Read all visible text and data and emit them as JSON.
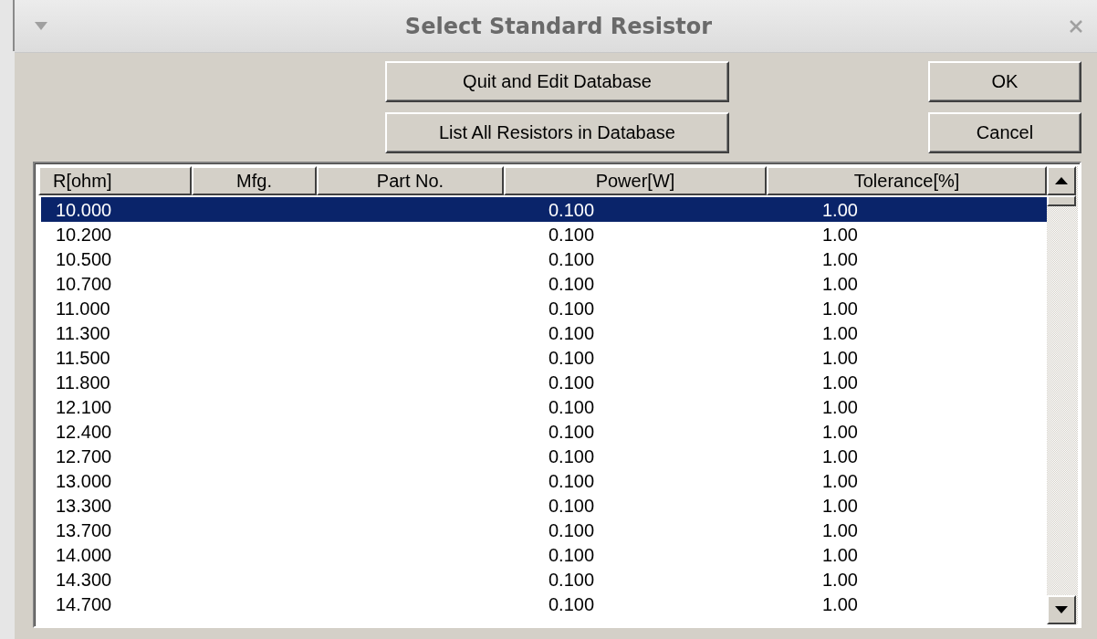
{
  "window": {
    "title": "Select Standard Resistor"
  },
  "buttons": [
    {
      "label": "Quit and Edit Database"
    },
    {
      "label": "OK"
    },
    {
      "label": "List All Resistors in Database"
    },
    {
      "label": "Cancel"
    }
  ],
  "table": {
    "columns": [
      "R[ohm]",
      "Mfg.",
      "Part No.",
      "Power[W]",
      "Tolerance[%]"
    ],
    "rows": [
      {
        "r": "10.000",
        "power": "0.100",
        "tolerance": "1.00",
        "selected": true
      },
      {
        "r": "10.200",
        "power": "0.100",
        "tolerance": "1.00",
        "selected": false
      },
      {
        "r": "10.500",
        "power": "0.100",
        "tolerance": "1.00",
        "selected": false
      },
      {
        "r": "10.700",
        "power": "0.100",
        "tolerance": "1.00",
        "selected": false
      },
      {
        "r": "11.000",
        "power": "0.100",
        "tolerance": "1.00",
        "selected": false
      },
      {
        "r": "11.300",
        "power": "0.100",
        "tolerance": "1.00",
        "selected": false
      },
      {
        "r": "11.500",
        "power": "0.100",
        "tolerance": "1.00",
        "selected": false
      },
      {
        "r": "11.800",
        "power": "0.100",
        "tolerance": "1.00",
        "selected": false
      },
      {
        "r": "12.100",
        "power": "0.100",
        "tolerance": "1.00",
        "selected": false
      },
      {
        "r": "12.400",
        "power": "0.100",
        "tolerance": "1.00",
        "selected": false
      },
      {
        "r": "12.700",
        "power": "0.100",
        "tolerance": "1.00",
        "selected": false
      },
      {
        "r": "13.000",
        "power": "0.100",
        "tolerance": "1.00",
        "selected": false
      },
      {
        "r": "13.300",
        "power": "0.100",
        "tolerance": "1.00",
        "selected": false
      },
      {
        "r": "13.700",
        "power": "0.100",
        "tolerance": "1.00",
        "selected": false
      },
      {
        "r": "14.000",
        "power": "0.100",
        "tolerance": "1.00",
        "selected": false
      },
      {
        "r": "14.300",
        "power": "0.100",
        "tolerance": "1.00",
        "selected": false
      },
      {
        "r": "14.700",
        "power": "0.100",
        "tolerance": "1.00",
        "selected": false
      }
    ]
  }
}
